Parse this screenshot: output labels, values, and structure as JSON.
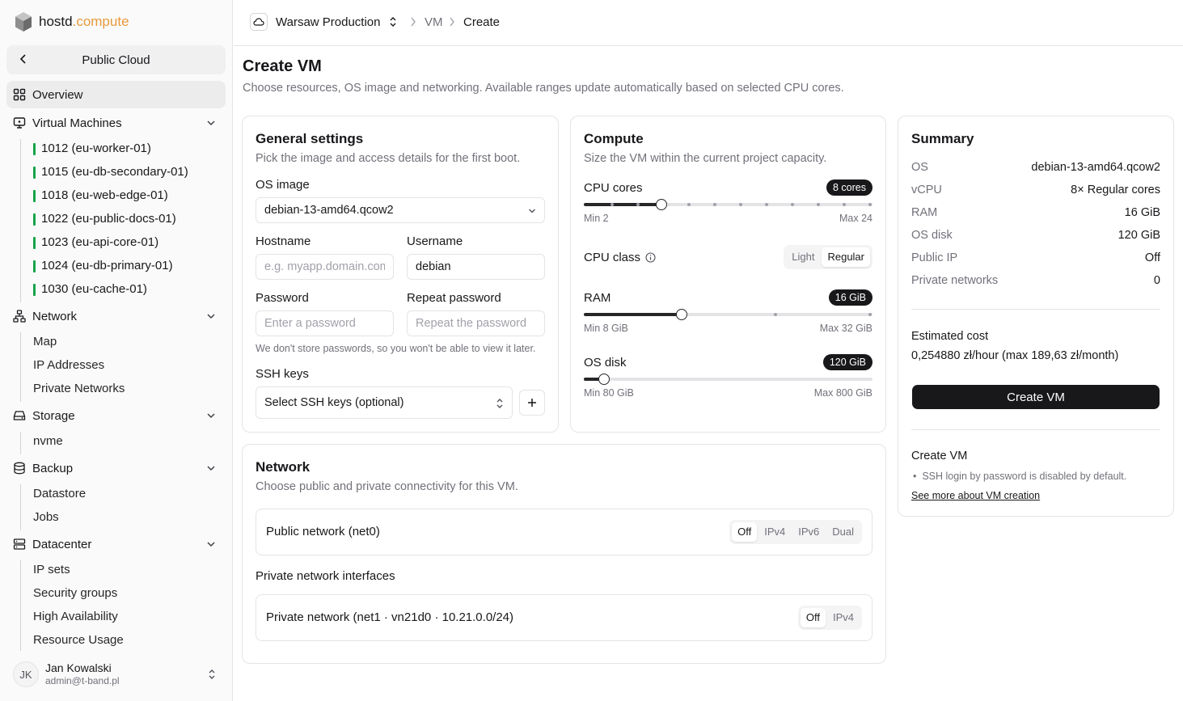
{
  "brand": {
    "part1": "hostd",
    "part2": ".compute"
  },
  "sidebar": {
    "back_label": "Public Cloud",
    "overview": "Overview",
    "vms_label": "Virtual Machines",
    "vms": [
      "1012 (eu-worker-01)",
      "1015 (eu-db-secondary-01)",
      "1018 (eu-web-edge-01)",
      "1022 (eu-public-docs-01)",
      "1023 (eu-api-core-01)",
      "1024 (eu-db-primary-01)",
      "1030 (eu-cache-01)"
    ],
    "network_label": "Network",
    "network_items": [
      "Map",
      "IP Addresses",
      "Private Networks"
    ],
    "storage_label": "Storage",
    "storage_items": [
      "nvme"
    ],
    "backup_label": "Backup",
    "backup_items": [
      "Datastore",
      "Jobs"
    ],
    "datacenter_label": "Datacenter",
    "datacenter_items": [
      "IP sets",
      "Security groups",
      "High Availability",
      "Resource Usage"
    ],
    "status_color": "#16a34a"
  },
  "user": {
    "initials": "JK",
    "name": "Jan Kowalski",
    "email": "admin@t-band.pl"
  },
  "breadcrumb": {
    "project": "Warsaw Production",
    "section": "VM",
    "page": "Create"
  },
  "page": {
    "title": "Create VM",
    "description": "Choose resources, OS image and networking. Available ranges update automatically based on selected CPU cores."
  },
  "general": {
    "title": "General settings",
    "description": "Pick the image and access details for the first boot.",
    "os_label": "OS image",
    "os_value": "debian-13-amd64.qcow2",
    "hostname_label": "Hostname",
    "hostname_placeholder": "e.g. myapp.domain.com",
    "username_label": "Username",
    "username_value": "debian",
    "password_label": "Password",
    "password_placeholder": "Enter a password",
    "repeat_label": "Repeat password",
    "repeat_placeholder": "Repeat the password",
    "password_hint": "We don't store passwords, so you won't be able to view it later.",
    "ssh_label": "SSH keys",
    "ssh_placeholder": "Select SSH keys (optional)"
  },
  "compute": {
    "title": "Compute",
    "description": "Size the VM within the current project capacity.",
    "cpu_label": "CPU cores",
    "cpu_badge": "8 cores",
    "cpu_min": "Min 2",
    "cpu_max": "Max 24",
    "cpu_fill": 0.27,
    "class_label": "CPU class",
    "class_options": [
      "Light",
      "Regular"
    ],
    "ram_label": "RAM",
    "ram_badge": "16 GiB",
    "ram_min": "Min 8 GiB",
    "ram_max": "Max 32 GiB",
    "ram_fill": 0.34,
    "disk_label": "OS disk",
    "disk_badge": "120 GiB",
    "disk_min": "Min 80 GiB",
    "disk_max": "Max 800 GiB",
    "disk_fill": 0.07
  },
  "network": {
    "title": "Network",
    "description": "Choose public and private connectivity for this VM.",
    "public_label": "Public network (net0)",
    "public_options": [
      "Off",
      "IPv4",
      "IPv6",
      "Dual"
    ],
    "private_heading": "Private network interfaces",
    "private_label": "Private network (net1 · vn21d0 · 10.21.0.0/24)",
    "private_options": [
      "Off",
      "IPv4"
    ]
  },
  "summary": {
    "title": "Summary",
    "rows": [
      {
        "k": "OS",
        "v": "debian-13-amd64.qcow2"
      },
      {
        "k": "vCPU",
        "v": "8× Regular cores"
      },
      {
        "k": "RAM",
        "v": "16 GiB"
      },
      {
        "k": "OS disk",
        "v": "120 GiB"
      },
      {
        "k": "Public IP",
        "v": "Off"
      },
      {
        "k": "Private networks",
        "v": "0"
      }
    ],
    "cost_label": "Estimated cost",
    "cost_value": "0,254880 zł/hour (max 189,63 zł/month)",
    "create_button": "Create VM",
    "info_title": "Create VM",
    "info_bullet": "SSH login by password is disabled by default.",
    "info_link": "See more about VM creation"
  }
}
